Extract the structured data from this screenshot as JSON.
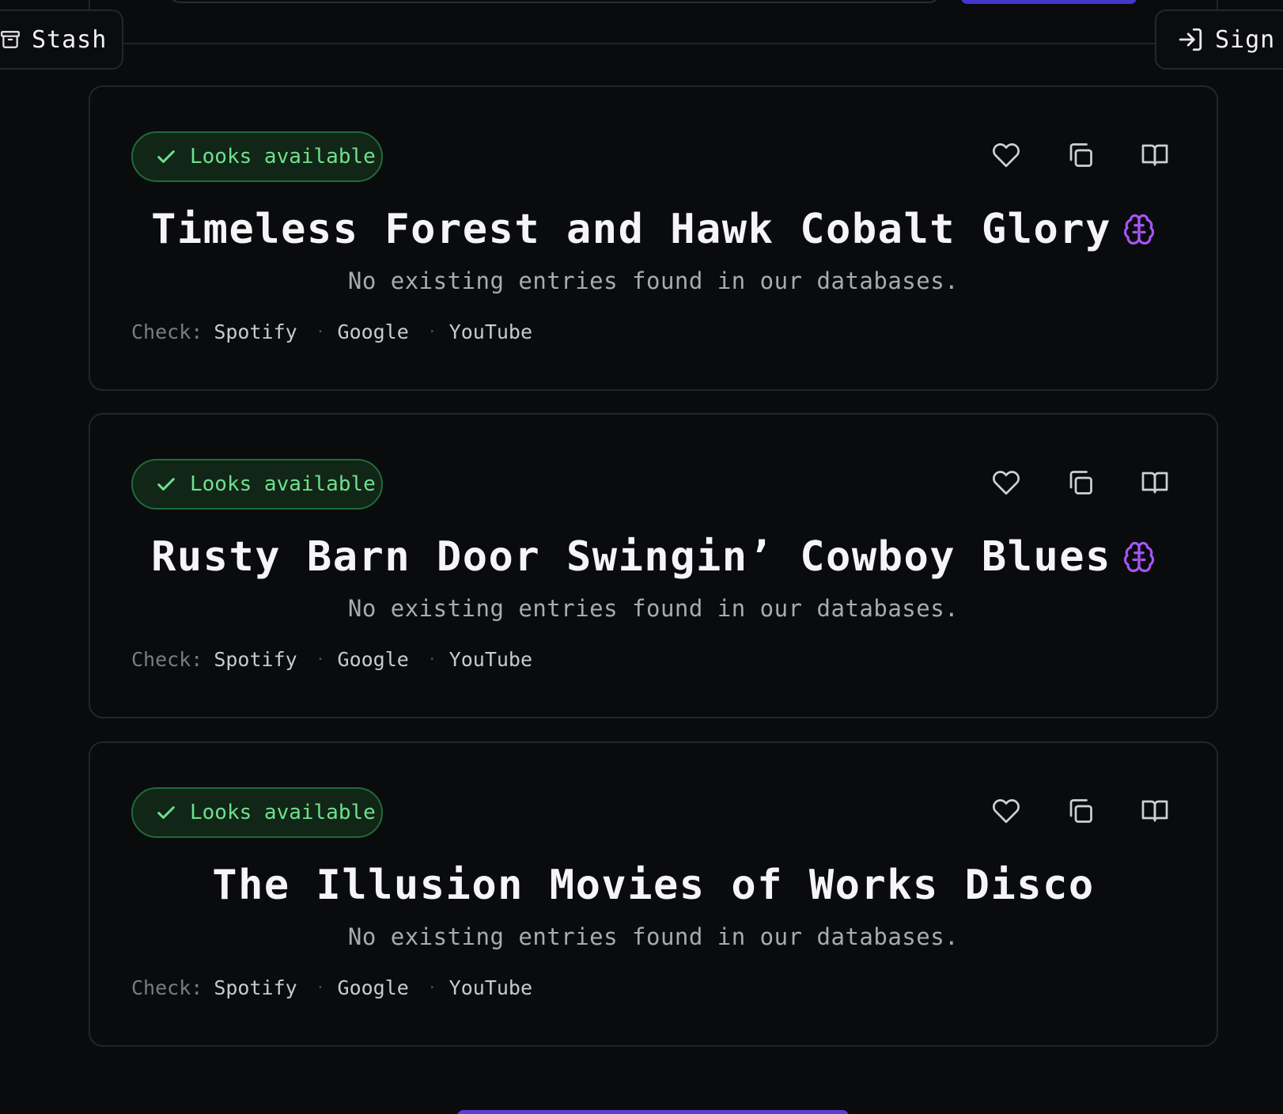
{
  "header": {
    "stash_label": "Stash",
    "sign_label": "Sign"
  },
  "cards": [
    {
      "badge": "Looks available",
      "title": "Timeless Forest and Hawk Cobalt Glory",
      "has_ai_icon": true,
      "subtitle": "No existing entries found in our databases.",
      "check_label": "Check:",
      "links": [
        "Spotify",
        "Google",
        "YouTube"
      ]
    },
    {
      "badge": "Looks available",
      "title": "Rusty Barn Door Swingin’ Cowboy Blues",
      "has_ai_icon": true,
      "subtitle": "No existing entries found in our databases.",
      "check_label": "Check:",
      "links": [
        "Spotify",
        "Google",
        "YouTube"
      ]
    },
    {
      "badge": "Looks available",
      "title": "The Illusion Movies of Works Disco",
      "has_ai_icon": false,
      "subtitle": "No existing entries found in our databases.",
      "check_label": "Check:",
      "links": [
        "Spotify",
        "Google",
        "YouTube"
      ]
    }
  ],
  "icons": {
    "badge": "check-icon",
    "actions": [
      "heart-icon",
      "copy-icon",
      "book-icon"
    ],
    "ai": "brain-icon",
    "stash": "archive-icon",
    "sign": "sign-in-icon"
  },
  "colors": {
    "background": "#0a0b0d",
    "badge_text": "#6ee08e",
    "badge_bg": "#112616",
    "ai_icon": "#a855f7",
    "accent": "#4338ca"
  }
}
